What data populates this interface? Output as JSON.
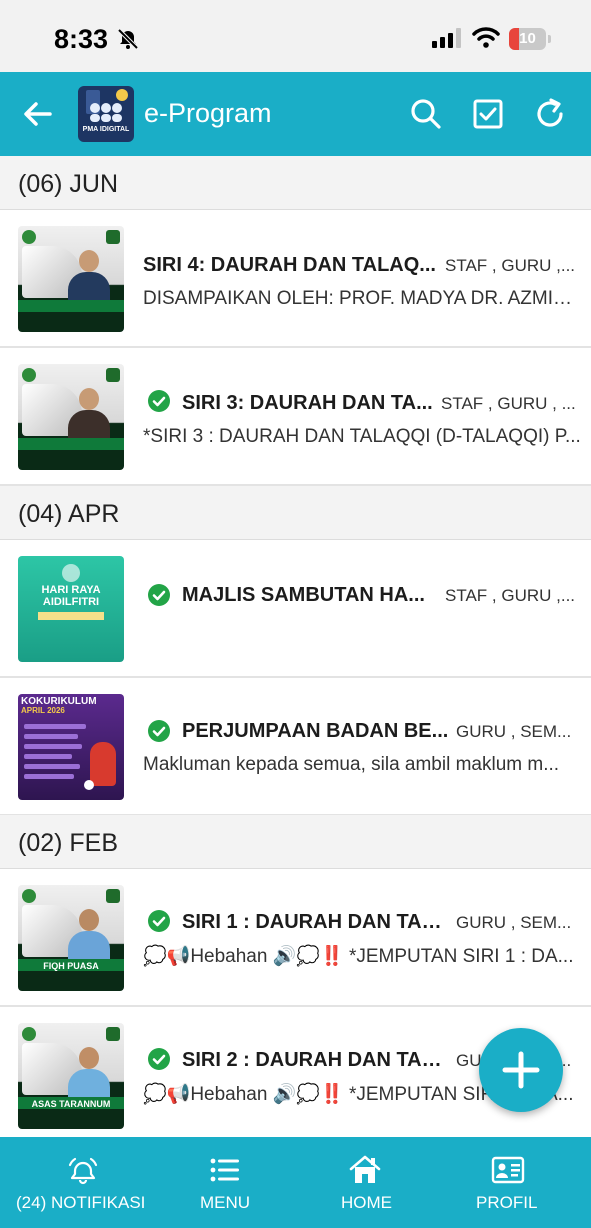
{
  "status_bar": {
    "time": "8:33",
    "battery": "10"
  },
  "app_bar": {
    "title": "e-Program",
    "logo_text": "PMA IDIGITAL"
  },
  "sections": [
    {
      "label": "(06) JUN",
      "items": [
        {
          "title": "SIRI 4: DAURAH DAN TALAQ...",
          "tags": "STAF , GURU ,...",
          "description": "DISAMPAIKAN OLEH: PROF. MADYA DR. AZMIL (...",
          "completed": false
        },
        {
          "title": "SIRI 3: DAURAH DAN TA...",
          "tags": "STAF , GURU , ...",
          "description": "*SIRI 3 : DAURAH DAN TALAQQI (D-TALAQQI) P...",
          "completed": true
        }
      ]
    },
    {
      "label": "(04) APR",
      "items": [
        {
          "title": "MAJLIS SAMBUTAN HA...",
          "tags": "STAF , GURU ,...",
          "description": "",
          "completed": true,
          "thumb_text": "HARI RAYA AIDILFITRI"
        },
        {
          "title": "PERJUMPAAN BADAN BE...",
          "tags": "GURU , SEM...",
          "description": "Makluman kepada semua, sila ambil maklum m...",
          "completed": true,
          "thumb_text": "KOKURIKULUM",
          "thumb_sub": "APRIL 2026"
        }
      ]
    },
    {
      "label": "(02) FEB",
      "items": [
        {
          "title": "SIRI 1 : DAURAH DAN TAL...",
          "tags": "GURU , SEM...",
          "description": "💭📢Hebahan 🔊💭‼️ *JEMPUTAN SIRI 1 : DA...",
          "completed": true,
          "thumb_caption": "FIQH PUASA"
        },
        {
          "title": "SIRI 2 : DAURAH DAN TAL...",
          "tags": "GURU , SEM...",
          "description": "💭📢Hebahan 🔊💭‼️ *JEMPUTAN SIRI 2 : DA...",
          "completed": true,
          "thumb_caption": "ASAS TARANNUM"
        }
      ]
    }
  ],
  "bottom_nav": [
    {
      "label": "(24) NOTIFIKASI",
      "icon": "bell-icon"
    },
    {
      "label": "MENU",
      "icon": "list-icon"
    },
    {
      "label": "HOME",
      "icon": "home-icon"
    },
    {
      "label": "PROFIL",
      "icon": "id-card-icon"
    }
  ],
  "fab": {
    "icon": "plus-icon"
  },
  "colors": {
    "primary": "#1aaec7",
    "check_green": "#22a447",
    "section_bg": "#f3f3f3"
  }
}
